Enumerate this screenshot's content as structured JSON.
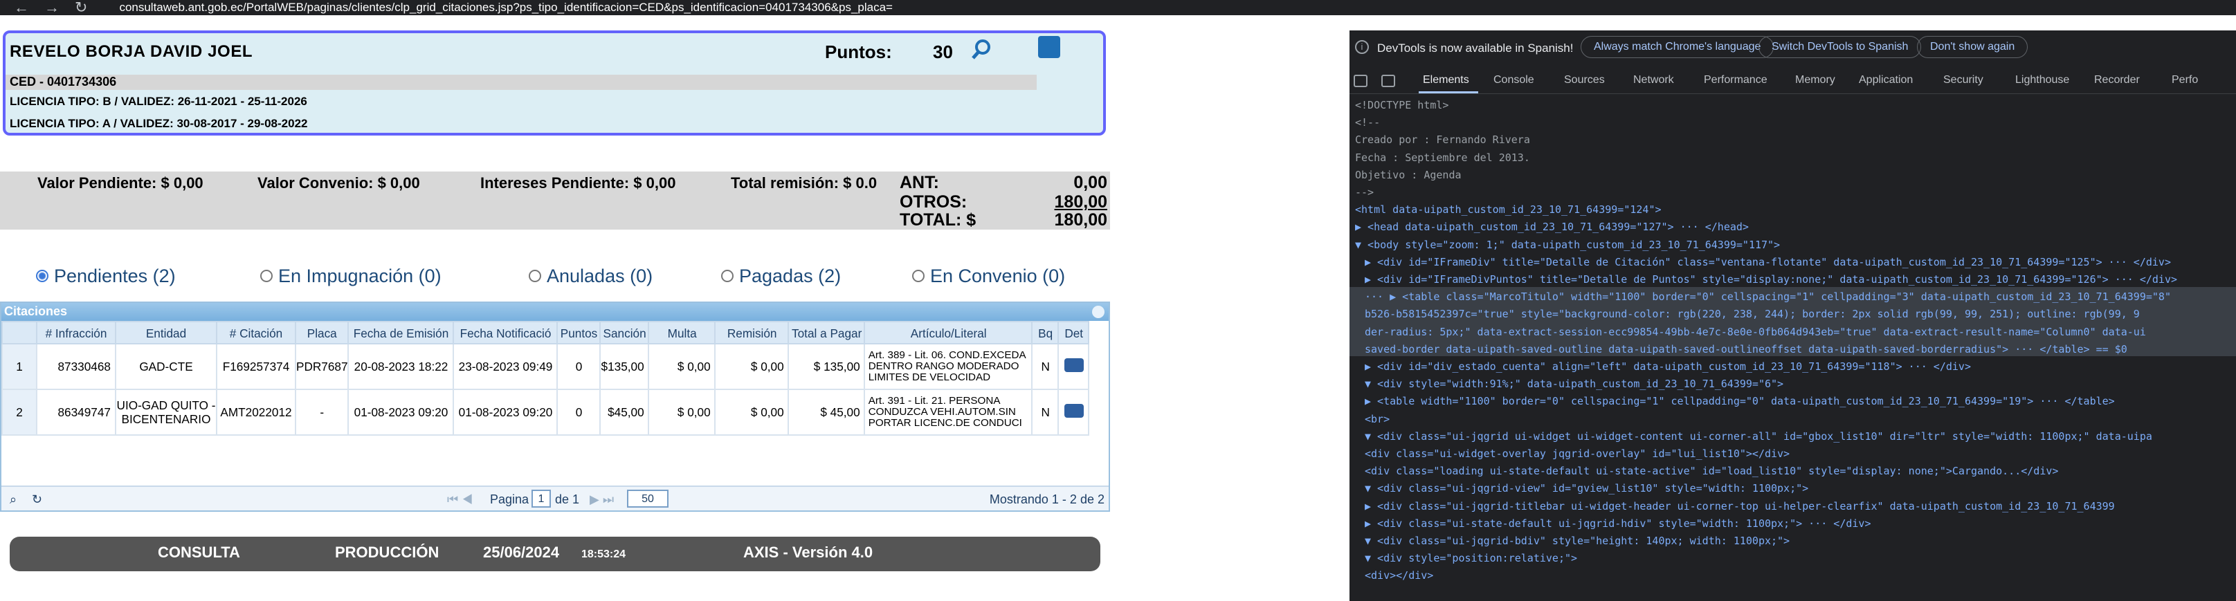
{
  "browser": {
    "url": "consultaweb.ant.gob.ec/PortalWEB/paginas/clientes/clp_grid_citaciones.jsp?ps_tipo_identificacion=CED&ps_identificacion=0401734306&ps_placa="
  },
  "header": {
    "name": "REVELO BORJA DAVID JOEL",
    "puntos_label": "Puntos:",
    "puntos_value": "30",
    "ced": "CED - 0401734306",
    "licencia1": "LICENCIA TIPO: B   / VALIDEZ: 26-11-2021 - 25-11-2026",
    "licencia2": "LICENCIA TIPO: A   / VALIDEZ: 30-08-2017 - 29-08-2022"
  },
  "totals": {
    "valor_pendiente": "Valor Pendiente: $  0,00",
    "valor_convenio": "Valor Convenio: $  0,00",
    "intereses": "Intereses Pendiente: $  0,00",
    "remision": "Total remisión: $ 0.0",
    "ant_label": "ANT:",
    "ant_value": "0,00",
    "otros_label": "OTROS:",
    "otros_value": "180,00",
    "total_label": "TOTAL: $",
    "total_value": "180,00"
  },
  "filters": [
    {
      "label": "Pendientes (2)",
      "selected": true
    },
    {
      "label": "En Impugnación (0)",
      "selected": false
    },
    {
      "label": "Anuladas (0)",
      "selected": false
    },
    {
      "label": "Pagadas (2)",
      "selected": false
    },
    {
      "label": "En Convenio (0)",
      "selected": false
    }
  ],
  "grid": {
    "caption": "Citaciones",
    "headers": [
      "",
      "# Infracción",
      "Entidad",
      "# Citación",
      "Placa",
      "Fecha de Emisión",
      "Fecha Notificació",
      "Puntos",
      "Sanción",
      "Multa",
      "Remisión",
      "Total a Pagar",
      "Artículo/Literal",
      "Bq",
      "Det"
    ],
    "rows": [
      {
        "n": "1",
        "infraccion": "87330468",
        "entidad": "GAD-CTE",
        "citacion": "F169257374",
        "placa": "PDR7687",
        "emision": "20-08-2023 18:22",
        "notificacion": "23-08-2023 09:49",
        "puntos": "0",
        "sancion": "$135,00",
        "multa": "$ 0,00",
        "remision": "$ 0,00",
        "total": "$ 135,00",
        "articulo": "Art. 389 - Lit. 06. COND.EXCEDA DENTRO RANGO MODERADO LIMITES DE VELOCIDAD",
        "bq": "N"
      },
      {
        "n": "2",
        "infraccion": "86349747",
        "entidad": "UIO-GAD QUITO - BICENTENARIO",
        "citacion": "AMT2022012",
        "placa": "-",
        "emision": "01-08-2023 09:20",
        "notificacion": "01-08-2023 09:20",
        "puntos": "0",
        "sancion": "$45,00",
        "multa": "$ 0,00",
        "remision": "$ 0,00",
        "total": "$ 45,00",
        "articulo": "Art. 391 - Lit. 21. PERSONA CONDUZCA VEHI.AUTOM.SIN PORTAR LICENC.DE CONDUCI",
        "bq": "N"
      }
    ],
    "pager": {
      "page_label": "Pagina",
      "page": "1",
      "of_label": "de 1",
      "rows": "50",
      "showing": "Mostrando 1 - 2 de 2"
    }
  },
  "footer": {
    "consulta": "CONSULTA",
    "produccion": "PRODUCCIÓN",
    "date": "25/06/2024",
    "time": "18:53:24",
    "version": "AXIS - Versión 4.0"
  },
  "devtools": {
    "notice": "DevTools is now available in Spanish!",
    "btn1": "Always match Chrome's language",
    "btn2": "Switch DevTools to Spanish",
    "btn3": "Don't show again",
    "tabs": [
      "Elements",
      "Console",
      "Sources",
      "Network",
      "Performance",
      "Memory",
      "Application",
      "Security",
      "Lighthouse",
      "Recorder",
      "Perfo"
    ],
    "lines": [
      "<!DOCTYPE html>",
      "<!--",
      "    Creado por : Fernando Rivera",
      "    Fecha      : Septiembre del 2013.",
      "    Objetivo   : Agenda",
      "-->",
      "<html data-uipath_custom_id_23_10_71_64399=\"124\">",
      "▶ <head data-uipath_custom_id_23_10_71_64399=\"127\"> ··· </head>",
      "▼ <body style=\"zoom: 1;\" data-uipath_custom_id_23_10_71_64399=\"117\">",
      "  ▶ <div id=\"IFrameDiv\" title=\"Detalle de Citación\" class=\"ventana-flotante\" data-uipath_custom_id_23_10_71_64399=\"125\"> ··· </div>",
      "  ▶ <div id=\"IFrameDivPuntos\" title=\"Detalle de Puntos\" style=\"display:none;\" data-uipath_custom_id_23_10_71_64399=\"126\"> ··· </div>",
      "··· ▶ <table class=\"MarcoTitulo\" width=\"1100\" border=\"0\" cellspacing=\"1\" cellpadding=\"3\" data-uipath_custom_id_23_10_71_64399=\"8\"",
      "  b526-b5815452397c=\"true\" style=\"background-color: rgb(220, 238, 244); border: 2px solid rgb(99, 99, 251); outline: rgb(99, 9",
      "  der-radius: 5px;\" data-extract-session-ecc99854-49bb-4e7c-8e0e-0fb064d943eb=\"true\" data-extract-result-name=\"Column0\" data-ui",
      "  saved-border data-uipath-saved-outline data-uipath-saved-outlineoffset data-uipath-saved-borderradius\"> ··· </table> == $0",
      "  ▶ <div id=\"div_estado_cuenta\" align=\"left\" data-uipath_custom_id_23_10_71_64399=\"118\"> ··· </div>",
      "  ▼ <div style=\"width:91%;\" data-uipath_custom_id_23_10_71_64399=\"6\">",
      "    ▶ <table width=\"1100\" border=\"0\" cellspacing=\"1\" cellpadding=\"0\" data-uipath_custom_id_23_10_71_64399=\"19\"> ··· </table>",
      "      <br>",
      "    ▼ <div class=\"ui-jqgrid ui-widget ui-widget-content ui-corner-all\" id=\"gbox_list10\" dir=\"ltr\" style=\"width: 1100px;\" data-uipa",
      "        <div class=\"ui-widget-overlay jqgrid-overlay\" id=\"lui_list10\"></div>",
      "        <div class=\"loading ui-state-default ui-state-active\" id=\"load_list10\" style=\"display: none;\">Cargando...</div>",
      "      ▼ <div class=\"ui-jqgrid-view\" id=\"gview_list10\" style=\"width: 1100px;\">",
      "        ▶ <div class=\"ui-jqgrid-titlebar ui-widget-header ui-corner-top ui-helper-clearfix\" data-uipath_custom_id_23_10_71_64399",
      "        ▶ <div class=\"ui-state-default ui-jqgrid-hdiv\" style=\"width: 1100px;\"> ··· </div>",
      "        ▼ <div class=\"ui-jqgrid-bdiv\" style=\"height: 140px; width: 1100px;\">",
      "          ▼ <div style=\"position:relative;\">",
      "              <div></div>"
    ]
  }
}
